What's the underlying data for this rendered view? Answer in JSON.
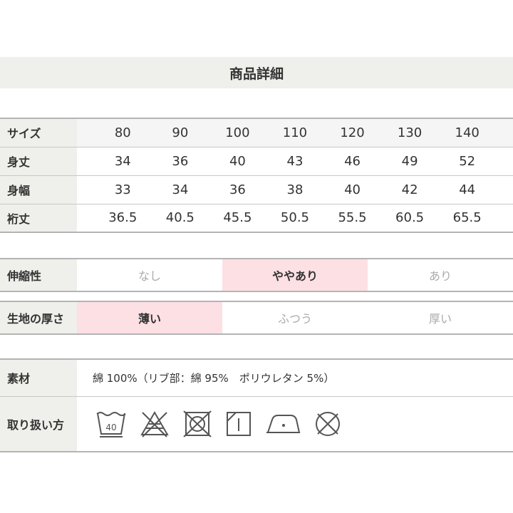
{
  "title": "商品詳細",
  "size_table": {
    "header_label": "サイズ",
    "sizes": [
      "80",
      "90",
      "100",
      "110",
      "120",
      "130",
      "140"
    ],
    "rows": [
      {
        "label": "身丈",
        "values": [
          "34",
          "36",
          "40",
          "43",
          "46",
          "49",
          "52"
        ]
      },
      {
        "label": "身幅",
        "values": [
          "33",
          "34",
          "36",
          "38",
          "40",
          "42",
          "44"
        ]
      },
      {
        "label": "裄丈",
        "values": [
          "36.5",
          "40.5",
          "45.5",
          "50.5",
          "55.5",
          "60.5",
          "65.5"
        ]
      }
    ]
  },
  "stretch": {
    "label": "伸縮性",
    "options": [
      "なし",
      "ややあり",
      "あり"
    ],
    "selected": "ややあり"
  },
  "thickness": {
    "label": "生地の厚さ",
    "options": [
      "薄い",
      "ふつう",
      "厚い"
    ],
    "selected": "薄い"
  },
  "material": {
    "label": "素材",
    "value": "綿 100%（リブ部：綿 95%　ポリウレタン 5%）"
  },
  "care": {
    "label": "取り扱い方",
    "wash_temp": "40",
    "icons": [
      "wash-40-icon",
      "no-bleach-icon",
      "no-tumble-dry-icon",
      "line-dry-shade-icon",
      "iron-low-icon",
      "no-dry-clean-icon"
    ]
  }
}
